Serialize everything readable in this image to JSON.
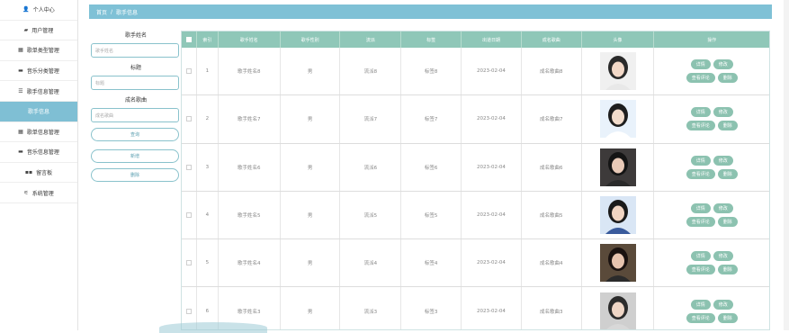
{
  "sidebar": {
    "items": [
      {
        "label": "个人中心",
        "icon": "user-icon",
        "glyph": "👤"
      },
      {
        "label": "用户管理",
        "icon": "briefcase-icon",
        "glyph": "▰"
      },
      {
        "label": "歌单类型管理",
        "icon": "grid-icon",
        "glyph": "▦"
      },
      {
        "label": "音乐分类管理",
        "icon": "monitor-icon",
        "glyph": "▬"
      },
      {
        "label": "歌手信息管理",
        "icon": "list-icon",
        "glyph": "☰"
      },
      {
        "label": "歌手信息",
        "icon": "",
        "glyph": "",
        "active": true
      },
      {
        "label": "歌单信息管理",
        "icon": "grid-icon",
        "glyph": "▦"
      },
      {
        "label": "音乐信息管理",
        "icon": "monitor-icon",
        "glyph": "▬"
      },
      {
        "label": "留言板",
        "icon": "apps-icon",
        "glyph": "▪▪"
      },
      {
        "label": "系统管理",
        "icon": "sliders-icon",
        "glyph": "⚟"
      }
    ]
  },
  "breadcrumb": {
    "home": "首页",
    "sep": "/",
    "current": "歌手信息"
  },
  "search": {
    "name_label": "歌手姓名",
    "name_placeholder": "歌手姓名",
    "title_label": "标题",
    "title_placeholder": "标题",
    "work_label": "成名歌曲",
    "work_placeholder": "成名歌曲",
    "search_btn": "查询",
    "add_btn": "新增",
    "delete_btn": "删除"
  },
  "table": {
    "headers": [
      "",
      "索引",
      "歌手姓名",
      "歌手性别",
      "流派",
      "标签",
      "出道日期",
      "成名歌曲",
      "头像",
      "操作"
    ],
    "ops": {
      "detail": "详情",
      "edit": "修改",
      "comments": "查看评论",
      "delete": "删除"
    },
    "rows": [
      {
        "index": "1",
        "name": "歌手姓名8",
        "gender": "男",
        "genre": "流派8",
        "tag": "标签8",
        "date": "2023-02-04",
        "song": "成名歌曲8"
      },
      {
        "index": "2",
        "name": "歌手姓名7",
        "gender": "男",
        "genre": "流派7",
        "tag": "标签7",
        "date": "2023-02-04",
        "song": "成名歌曲7"
      },
      {
        "index": "3",
        "name": "歌手姓名6",
        "gender": "男",
        "genre": "流派6",
        "tag": "标签6",
        "date": "2023-02-04",
        "song": "成名歌曲6"
      },
      {
        "index": "4",
        "name": "歌手姓名5",
        "gender": "男",
        "genre": "流派5",
        "tag": "标签5",
        "date": "2023-02-04",
        "song": "成名歌曲5"
      },
      {
        "index": "5",
        "name": "歌手姓名4",
        "gender": "男",
        "genre": "流派4",
        "tag": "标签4",
        "date": "2023-02-04",
        "song": "成名歌曲4"
      },
      {
        "index": "6",
        "name": "歌手姓名3",
        "gender": "男",
        "genre": "流派3",
        "tag": "标签3",
        "date": "2023-02-04",
        "song": "成名歌曲3"
      }
    ]
  },
  "colors": {
    "accent": "#7fc1d6",
    "header": "#8fc7b8",
    "button": "#8cc2b0"
  }
}
